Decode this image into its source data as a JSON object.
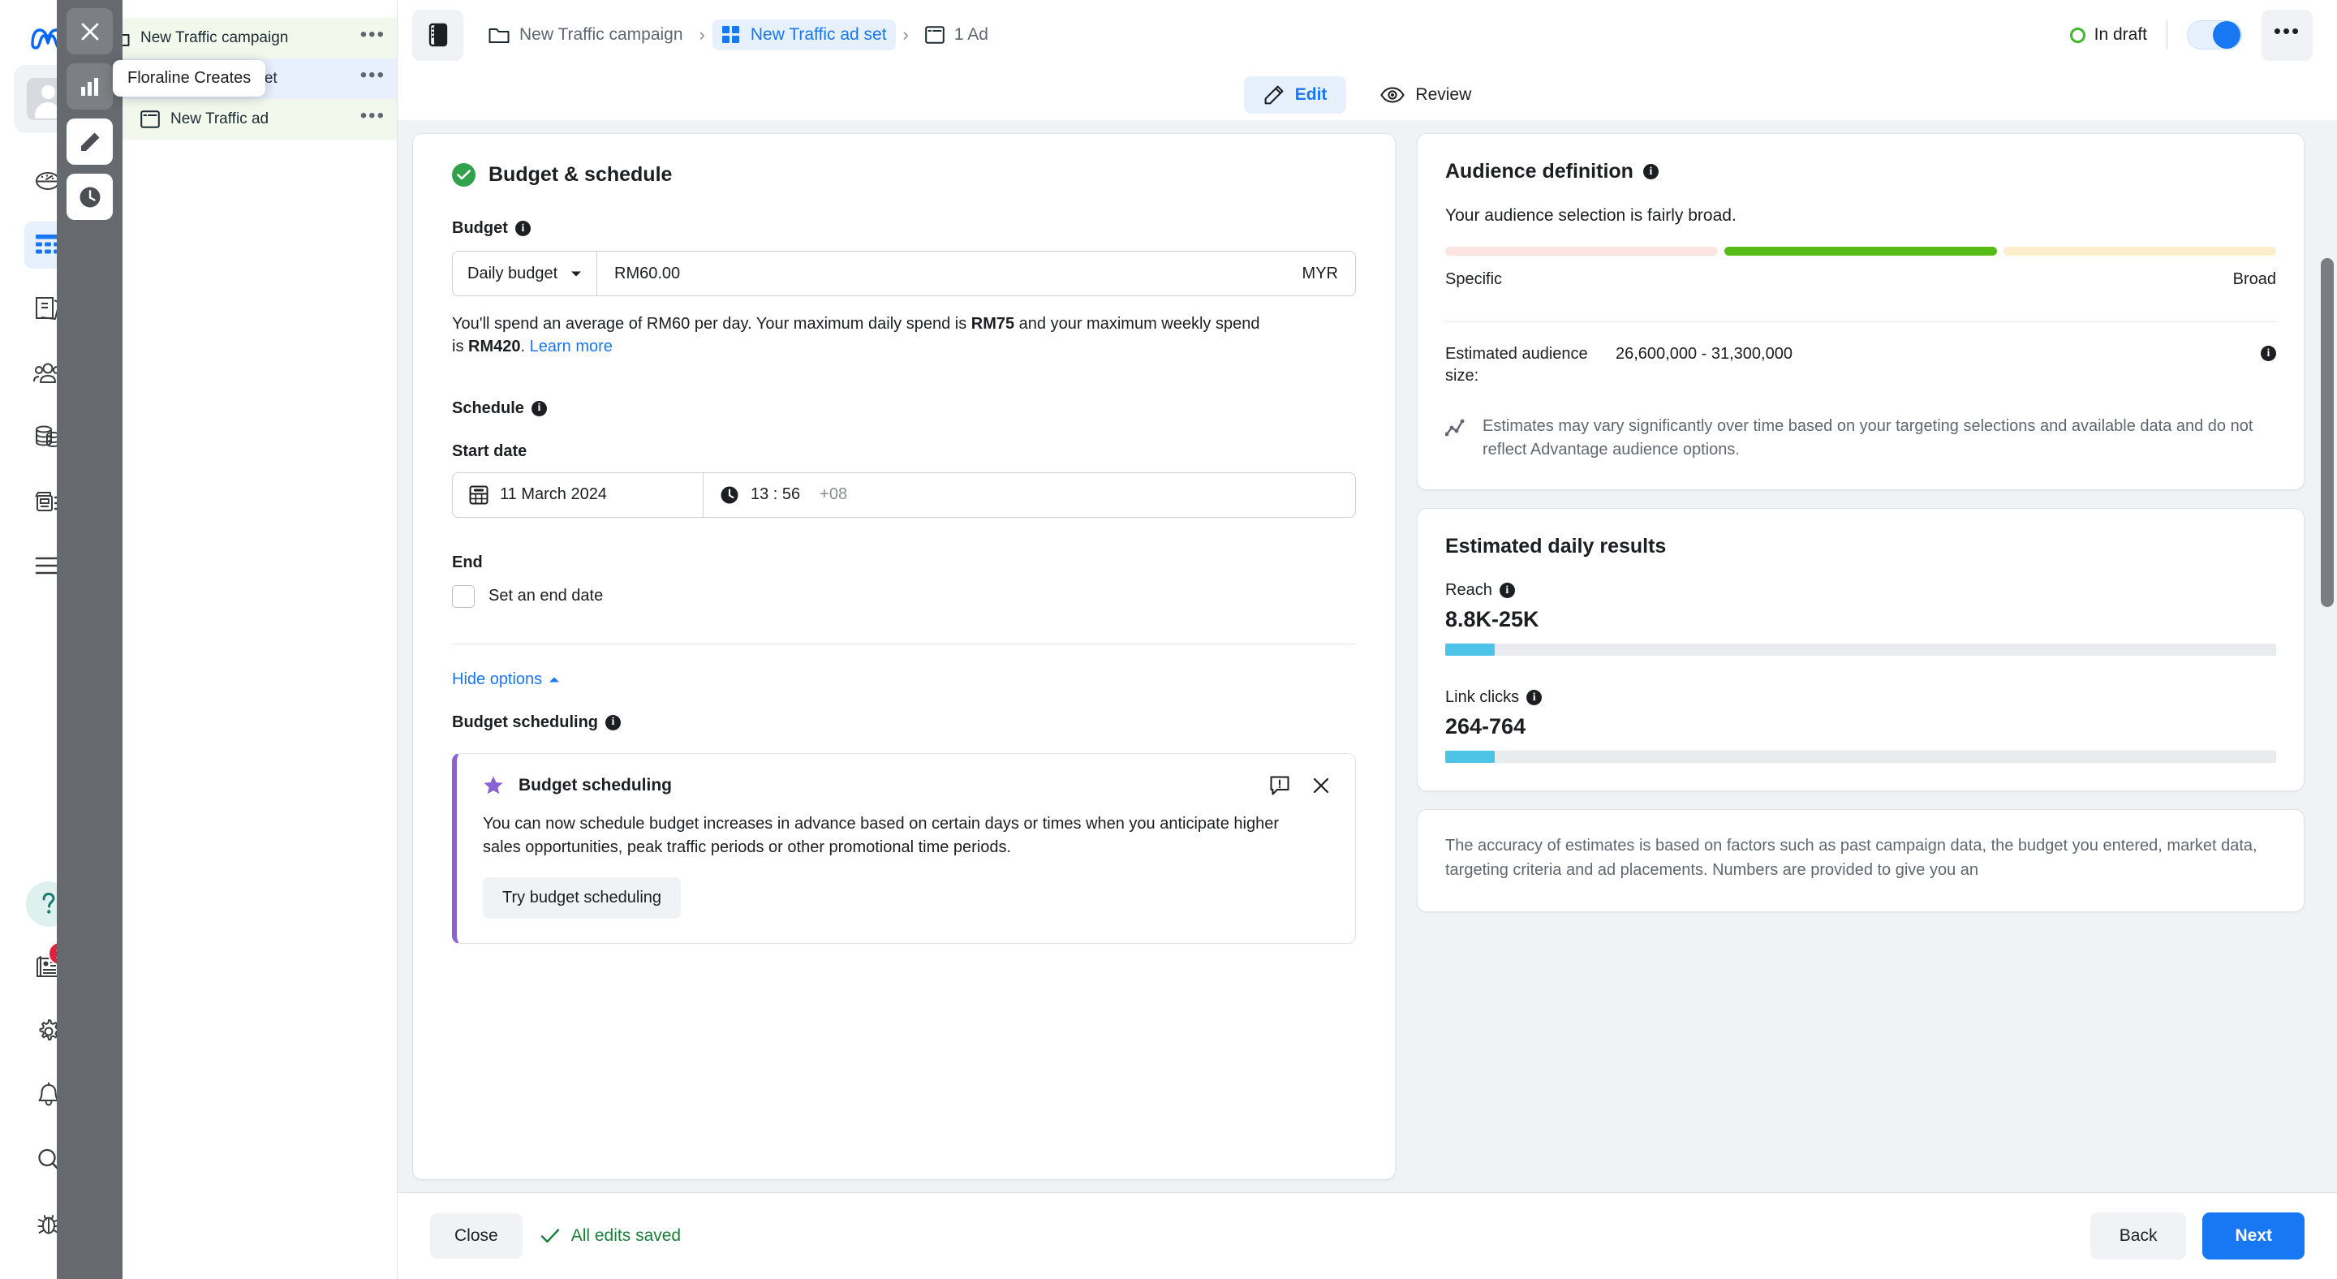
{
  "colors": {
    "brand_blue": "#1877f2",
    "green": "#42b72a",
    "check_green": "#31a24c",
    "purple": "#8a63d2",
    "cyan": "#4ec3e8",
    "saved_green": "#1a7f37",
    "badge_red": "#e41e3f"
  },
  "rail": {
    "logo": "meta-logo",
    "avatar": "account-avatar",
    "items": [
      {
        "icon": "dashboard-speedometer-icon",
        "name": "dashboard",
        "active": false
      },
      {
        "icon": "table-campaigns-icon",
        "name": "campaigns",
        "active": true
      },
      {
        "icon": "library-icon",
        "name": "library",
        "active": false
      },
      {
        "icon": "audiences-people-icon",
        "name": "audiences",
        "active": false
      },
      {
        "icon": "billing-coins-icon",
        "name": "billing",
        "active": false
      },
      {
        "icon": "ads-media-icon",
        "name": "ads",
        "active": false
      },
      {
        "icon": "hamburger-menu-icon",
        "name": "all-tools",
        "active": false
      }
    ],
    "bottom": [
      {
        "icon": "help-question-icon",
        "name": "help"
      },
      {
        "icon": "news-feed-icon",
        "name": "news",
        "badge": "1"
      },
      {
        "icon": "gear-icon",
        "name": "settings"
      },
      {
        "icon": "bell-icon",
        "name": "notifications"
      },
      {
        "icon": "search-icon",
        "name": "search"
      },
      {
        "icon": "bug-icon",
        "name": "report-bug"
      }
    ]
  },
  "mini_toolbar": {
    "tooltip": "Floraline Creates",
    "buttons": [
      {
        "icon": "close-x-icon",
        "name": "close-panel"
      },
      {
        "icon": "bar-chart-icon",
        "name": "insights"
      },
      {
        "icon": "pencil-edit-icon",
        "name": "edit",
        "active": true
      },
      {
        "icon": "clock-history-icon",
        "name": "history"
      }
    ]
  },
  "tree": {
    "rows": [
      {
        "icon": "folder-icon",
        "label": "New Traffic campaign",
        "level": "campaign",
        "menu": "•••"
      },
      {
        "icon": "grid-adset-icon",
        "label": "New Traffic ad set",
        "level": "adset",
        "menu": "•••"
      },
      {
        "icon": "ad-window-icon",
        "label": "New Traffic ad",
        "level": "ad",
        "menu": "•••"
      }
    ]
  },
  "topbar": {
    "panel_toggle": "side-panel-toggle-icon",
    "breadcrumbs": [
      {
        "icon": "folder-icon",
        "label": "New Traffic campaign",
        "active": false
      },
      {
        "icon": "grid-adset-icon",
        "label": "New Traffic ad set",
        "active": true
      },
      {
        "icon": "ad-window-icon",
        "label": "1 Ad",
        "active": false
      }
    ],
    "chevron": "›",
    "status": "In draft",
    "toggle_on": true,
    "more": "•••"
  },
  "tabs": [
    {
      "icon": "pencil-edit-icon",
      "label": "Edit",
      "active": true
    },
    {
      "icon": "eye-review-icon",
      "label": "Review",
      "active": false
    }
  ],
  "form": {
    "section_title": "Budget & schedule",
    "budget": {
      "label": "Budget",
      "type_value": "Daily budget",
      "amount_value": "RM60.00",
      "currency": "MYR",
      "help_prefix": "You'll spend an average of RM60 per day. Your maximum daily spend is ",
      "help_bold_1": "RM75",
      "help_mid": " and your maximum weekly spend is ",
      "help_bold_2": "RM420",
      "help_suffix": ". ",
      "learn_more": "Learn more"
    },
    "schedule": {
      "label": "Schedule",
      "start_date_label": "Start date",
      "start_date_value": "11 March 2024",
      "start_time_value": "13 : 56",
      "timezone": "+08",
      "end_label": "End",
      "end_checkbox_label": "Set an end date",
      "end_checked": false
    },
    "hide_options": "Hide options",
    "budget_scheduling": {
      "label": "Budget scheduling",
      "card_title": "Budget scheduling",
      "card_body": "You can now schedule budget increases in advance based on certain days or times when you anticipate higher sales opportunities, peak traffic periods or other promotional time periods.",
      "cta": "Try budget scheduling",
      "feedback_icon": "feedback-flag-icon",
      "close_icon": "close-x-icon",
      "star_icon": "star-icon"
    }
  },
  "audience": {
    "title": "Audience definition",
    "summary": "Your audience selection is fairly broad.",
    "meter_segments": [
      {
        "color": "#fce4e0",
        "name": "specific-segment"
      },
      {
        "color": "#57bb16",
        "name": "balanced-segment"
      },
      {
        "color": "#fdeecb",
        "name": "broad-segment"
      }
    ],
    "meter_left": "Specific",
    "meter_right": "Broad",
    "estimated_label": "Estimated audience size:",
    "estimated_value": "26,600,000 - 31,300,000",
    "note_icon": "trend-chart-icon",
    "note": "Estimates may vary significantly over time based on your targeting selections and available data and do not reflect Advantage audience options."
  },
  "daily_results": {
    "title": "Estimated daily results",
    "metrics": [
      {
        "label": "Reach",
        "value": "8.8K-25K",
        "fill_percent": 6
      },
      {
        "label": "Link clicks",
        "value": "264-764",
        "fill_percent": 6
      }
    ],
    "accuracy": "The accuracy of estimates is based on factors such as past campaign data, the budget you entered, market data, targeting criteria and ad placements. Numbers are provided to give you an"
  },
  "footer": {
    "close": "Close",
    "saved_text": "All edits saved",
    "saved_icon": "check-icon",
    "back": "Back",
    "next": "Next"
  }
}
